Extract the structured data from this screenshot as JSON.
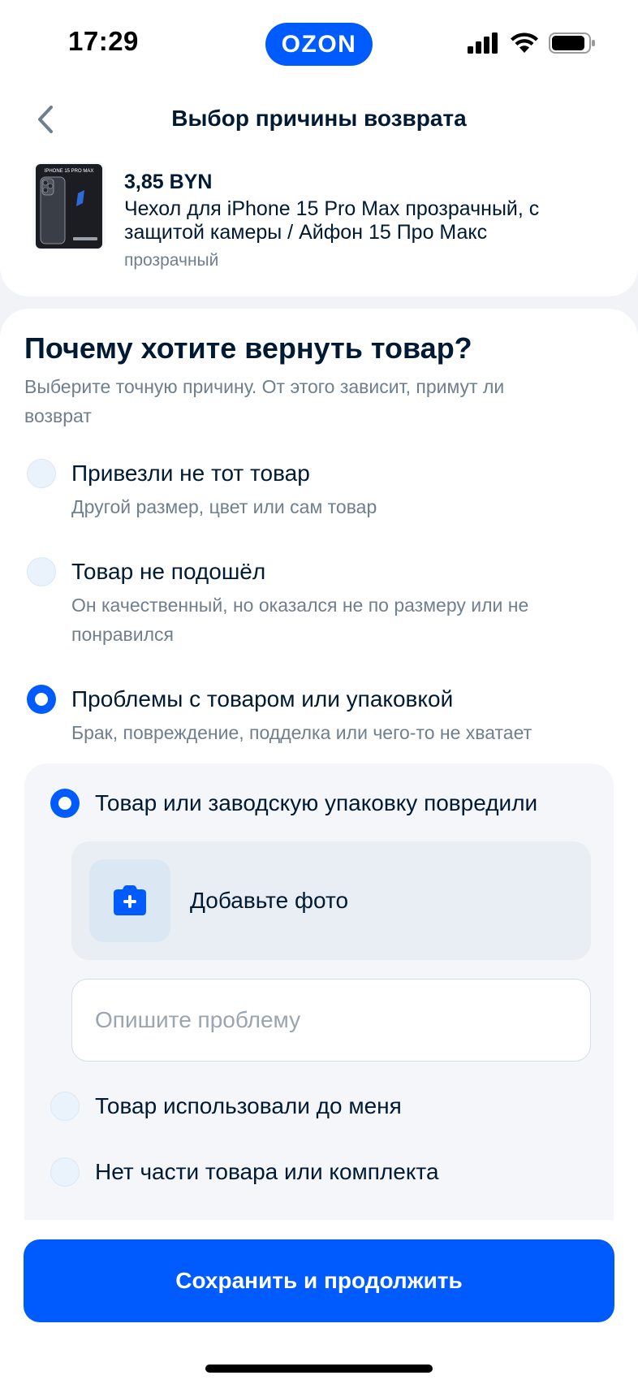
{
  "status_bar": {
    "time": "17:29",
    "brand": "OZON"
  },
  "header": {
    "title": "Выбор причины возврата"
  },
  "product": {
    "price": "3,85 BYN",
    "name": "Чехол для iPhone 15 Pro Max прозрачный, с защитой камеры / Айфон 15 Про Макс",
    "variant": "прозрачный",
    "thumb_text": "IPHONE 15 PRO MAX"
  },
  "section": {
    "title": "Почему хотите вернуть товар?",
    "description": "Выберите точную причину. От этого зависит, примут ли возврат"
  },
  "reasons": [
    {
      "label": "Привезли не тот товар",
      "sub": "Другой размер, цвет или сам товар",
      "checked": false
    },
    {
      "label": "Товар не подошёл",
      "sub": "Он качественный, но оказался не по размеру или не понравился",
      "checked": false
    },
    {
      "label": "Проблемы с товаром или упаковкой",
      "sub": "Брак, повреждение, подделка или чего-то не хватает",
      "checked": true
    }
  ],
  "sub_reasons": [
    {
      "label": "Товар или заводскую упаковку повредили",
      "checked": true
    },
    {
      "label": "Товар использовали до меня",
      "checked": false
    },
    {
      "label": "Нет части товара или комплекта",
      "checked": false
    }
  ],
  "photo": {
    "label": "Добавьте фото",
    "icon": "camera-plus-icon"
  },
  "describe": {
    "placeholder": "Опишите проблему",
    "value": ""
  },
  "footer": {
    "button_label": "Сохранить и продолжить"
  },
  "colors": {
    "accent": "#005bff",
    "text": "#001a34",
    "secondary_text": "#707f8d"
  }
}
